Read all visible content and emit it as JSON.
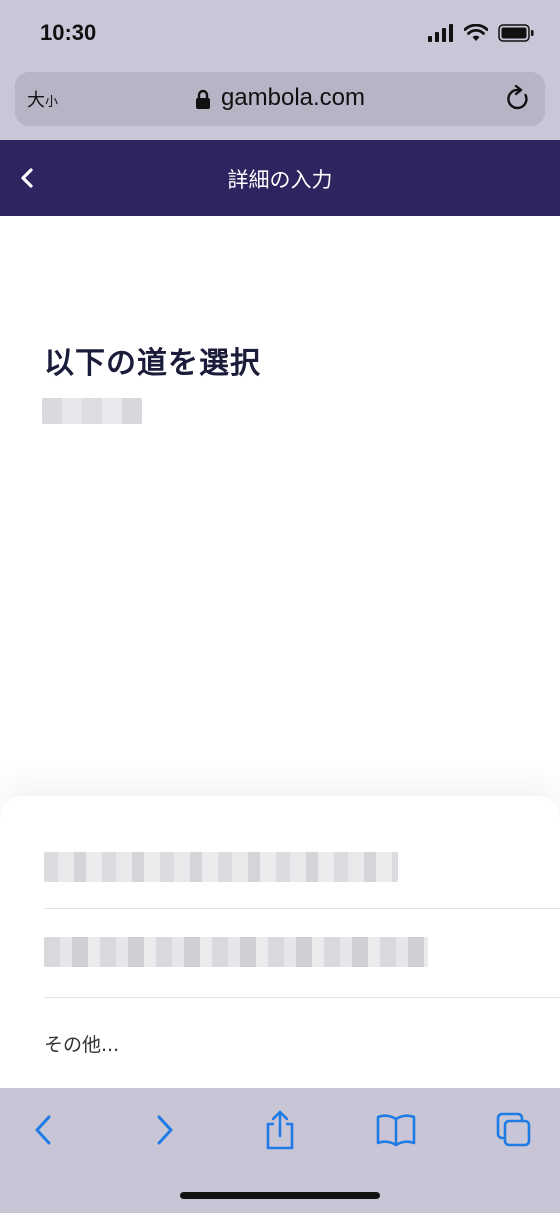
{
  "status_bar": {
    "time": "10:30"
  },
  "browser": {
    "text_size_label_large": "大",
    "text_size_label_small": "小",
    "url": "gambola.com"
  },
  "header": {
    "title": "詳細の入力"
  },
  "main": {
    "heading": "以下の道を選択"
  },
  "options": {
    "other_label": "その他..."
  },
  "colors": {
    "header_bg": "#2d2460",
    "browser_chrome": "#c9c7d7",
    "accent_blue": "#1e7be6"
  }
}
